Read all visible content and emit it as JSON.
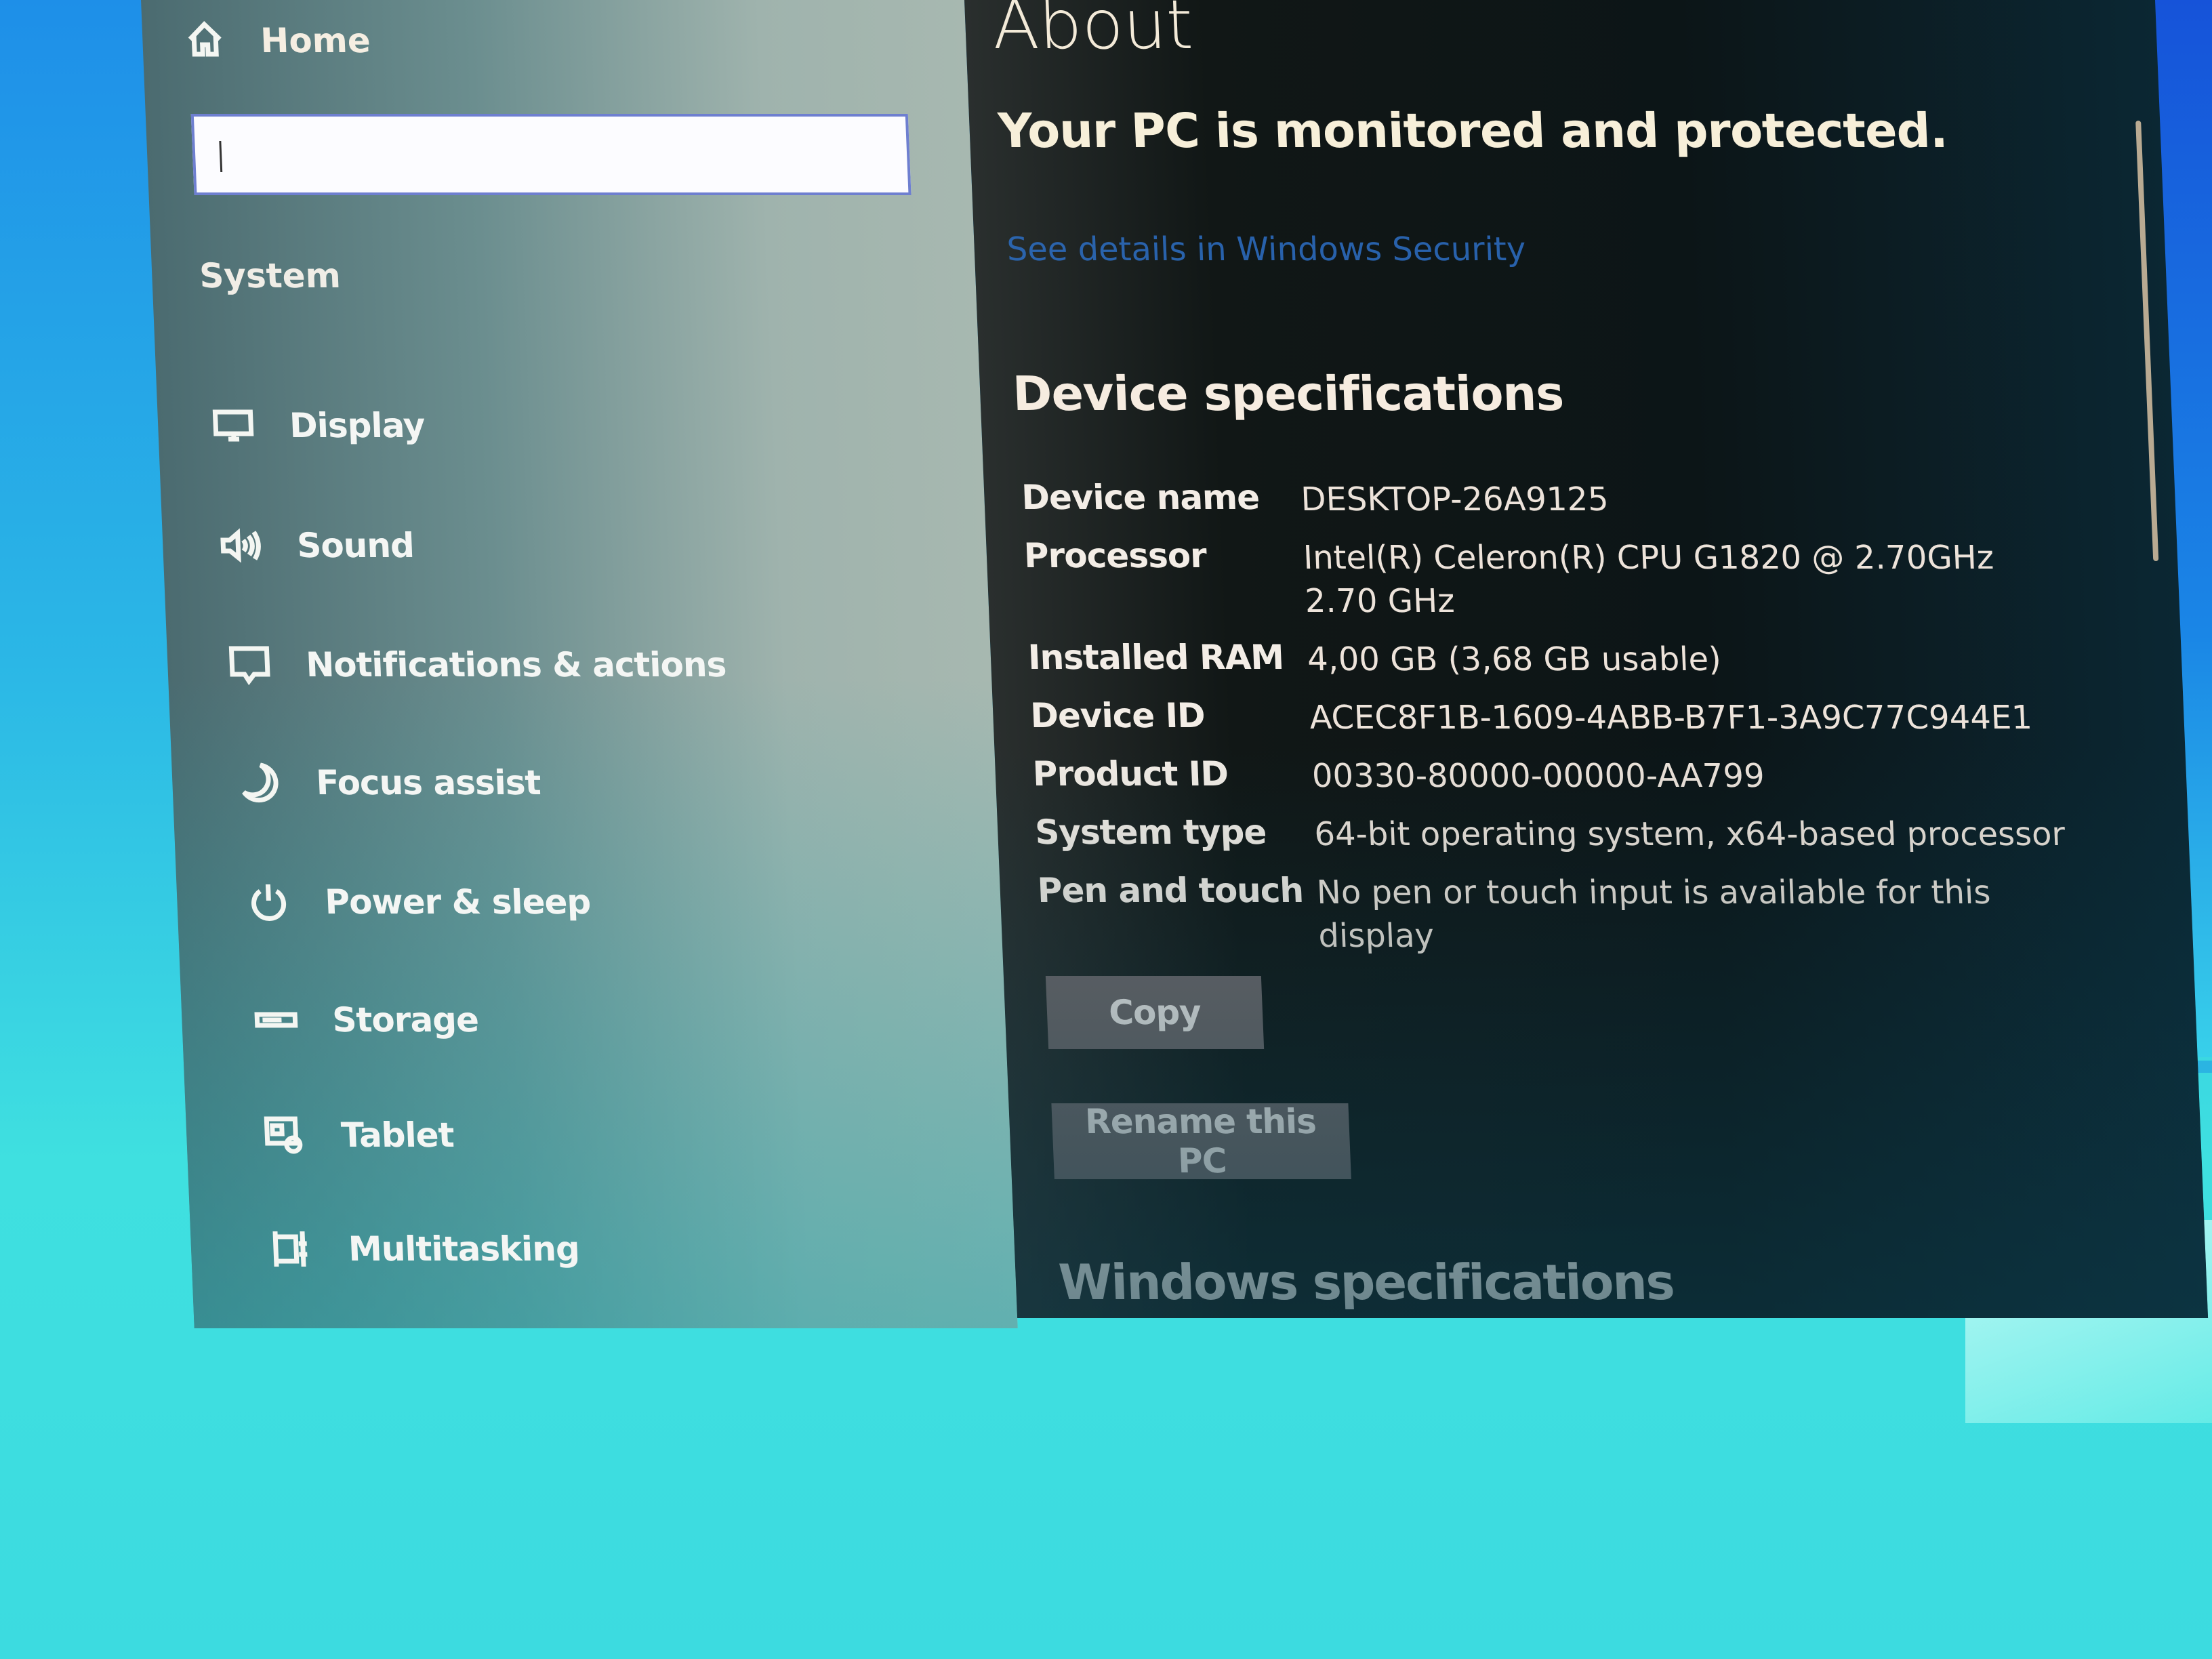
{
  "window": {
    "app": "Settings"
  },
  "sidebar": {
    "home_label": "Home",
    "home_icon": "home-icon",
    "search": {
      "value": "",
      "placeholder": ""
    },
    "section_label": "System",
    "items": [
      {
        "label": "Display",
        "icon": "display-icon"
      },
      {
        "label": "Sound",
        "icon": "speaker-icon"
      },
      {
        "label": "Notifications & actions",
        "icon": "notification-icon"
      },
      {
        "label": "Focus assist",
        "icon": "moon-icon"
      },
      {
        "label": "Power & sleep",
        "icon": "power-icon"
      },
      {
        "label": "Storage",
        "icon": "storage-icon"
      },
      {
        "label": "Tablet",
        "icon": "tablet-icon"
      },
      {
        "label": "Multitasking",
        "icon": "multitasking-icon"
      }
    ]
  },
  "main": {
    "title": "About",
    "status": "Your PC is monitored and protected.",
    "security_link": "See details in Windows Security",
    "device_specs_heading": "Device specifications",
    "specs": [
      {
        "key": "Device name",
        "value": "DESKTOP-26A9125"
      },
      {
        "key": "Processor",
        "value": "Intel(R) Celeron(R) CPU G1820 @ 2.70GHz   2.70 GHz"
      },
      {
        "key": "Installed RAM",
        "value": "4,00 GB (3,68 GB usable)"
      },
      {
        "key": "Device ID",
        "value": "ACEC8F1B-1609-4ABB-B7F1-3A9C77C944E1"
      },
      {
        "key": "Product ID",
        "value": "00330-80000-00000-AA799"
      },
      {
        "key": "System type",
        "value": "64-bit operating system, x64-based processor"
      },
      {
        "key": "Pen and touch",
        "value": "No pen or touch input is available for this display"
      }
    ],
    "copy_label": "Copy",
    "rename_label": "Rename this PC",
    "windows_specs_heading": "Windows specifications"
  },
  "colors": {
    "link": "#2d6fc5",
    "button_bg": "#6f6769",
    "content_bg": "#0c1517",
    "desktop": "#3cdbe0"
  }
}
